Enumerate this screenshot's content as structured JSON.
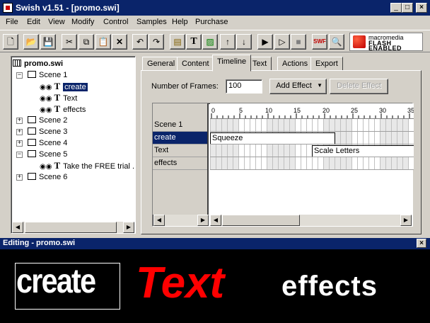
{
  "window": {
    "title": "Swish v1.51 - [promo.swi]"
  },
  "menu": [
    "File",
    "Edit",
    "View",
    "Modify",
    "Control",
    "Samples",
    "Help",
    "Purchase"
  ],
  "toolbar": {
    "buttons": [
      {
        "name": "new-file-icon",
        "glyph": "🗋"
      },
      {
        "name": "open-folder-icon",
        "glyph": "📂"
      },
      {
        "name": "save-icon",
        "glyph": "💾"
      },
      {
        "name": "cut-icon",
        "glyph": "✂"
      },
      {
        "name": "copy-icon",
        "glyph": "⧉"
      },
      {
        "name": "paste-icon",
        "glyph": "📋"
      },
      {
        "name": "delete-icon",
        "glyph": "✕"
      },
      {
        "name": "undo-icon",
        "glyph": "↶"
      },
      {
        "name": "redo-icon",
        "glyph": "↷"
      },
      {
        "name": "insert-scene-icon",
        "glyph": "▤"
      },
      {
        "name": "insert-text-icon",
        "glyph": "T"
      },
      {
        "name": "insert-image-icon",
        "glyph": "▨"
      },
      {
        "name": "move-up-icon",
        "glyph": "↑"
      },
      {
        "name": "move-down-icon",
        "glyph": "↓"
      },
      {
        "name": "play-icon",
        "glyph": "▶"
      },
      {
        "name": "play-scene-icon",
        "glyph": "▷"
      },
      {
        "name": "stop-icon",
        "glyph": "■"
      },
      {
        "name": "export-swf-icon",
        "glyph": "SWF"
      },
      {
        "name": "preview-browser-icon",
        "glyph": "🔍"
      }
    ],
    "logo": {
      "line1": "macromedia",
      "line2": "FLASH",
      "line3": "ENABLED"
    }
  },
  "tree": {
    "root": "promo.swi",
    "scene1": "Scene 1",
    "scene1_items": [
      "create",
      "Text",
      "effects"
    ],
    "scene2": "Scene 2",
    "scene3": "Scene 3",
    "scene4": "Scene 4",
    "scene5": "Scene 5",
    "scene5_items": [
      "Take the FREE trial ."
    ],
    "scene6": "Scene 6"
  },
  "tabs": [
    "General",
    "Content",
    "Timeline",
    "Text",
    "Actions",
    "Export"
  ],
  "active_tab": "Timeline",
  "timeline": {
    "frames_label": "Number of Frames:",
    "frames_value": "100",
    "add_effect_label": "Add Effect",
    "delete_effect_label": "Delete Effect",
    "ruler": [
      "0",
      "5",
      "10",
      "15",
      "20",
      "25",
      "30",
      "35"
    ],
    "rows": [
      "Scene 1",
      "create",
      "Text",
      "effects"
    ],
    "selected_row": "create",
    "effects": {
      "create": "Squeeze",
      "text": "Scale Letters"
    }
  },
  "editing": {
    "title": "Editing - promo.swi",
    "words": [
      "create",
      "Text",
      "effects"
    ],
    "colors": {
      "create": "#ffffff",
      "text": "#ff0000",
      "effects": "#ffffff"
    }
  },
  "colors": {
    "title_bar": "#0a246a",
    "face": "#d4d0c8"
  }
}
